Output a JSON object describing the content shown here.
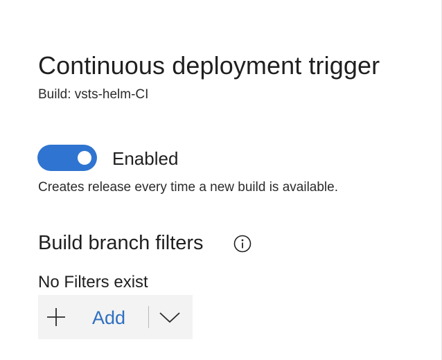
{
  "panel": {
    "title": "Continuous deployment trigger",
    "subtitle": "Build: vsts-helm-CI"
  },
  "trigger": {
    "enabled": true,
    "toggle_label": "Enabled",
    "description": "Creates release every time a new build is available."
  },
  "filters": {
    "section_title": "Build branch filters",
    "info_icon": "info-icon",
    "empty_text": "No Filters exist",
    "add_label": "Add",
    "add_icon": "plus-icon",
    "dropdown_icon": "chevron-down-icon"
  },
  "colors": {
    "toggle_on": "#2f74d0",
    "link_blue": "#2f6fc0",
    "button_background": "#f3f3f3"
  }
}
